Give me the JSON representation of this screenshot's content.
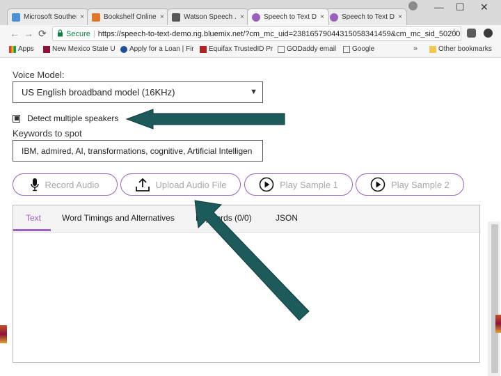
{
  "browser": {
    "tabs": [
      {
        "title": "Microsoft Souther...",
        "favicon_color": "#4a90d9",
        "active": false
      },
      {
        "title": "Bookshelf Online",
        "favicon_color": "#e0772b",
        "active": false
      },
      {
        "title": "Watson Speech ...",
        "favicon_color": "#555555",
        "active": false
      },
      {
        "title": "Speech to Text D...",
        "favicon_color": "#9b5fc0",
        "active": true
      },
      {
        "title": "Speech to Text D...",
        "favicon_color": "#9b5fc0",
        "active": false
      }
    ],
    "tab_close_glyph": "×",
    "window_controls": {
      "minimize": "—",
      "maximize": "☐",
      "close": "✕"
    },
    "nav": {
      "back": "←",
      "forward": "→",
      "reload": "⟳"
    },
    "secure_label": "Secure",
    "url": "https://speech-to-text-demo.ng.bluemix.net/?cm_mc_uid=23816579044315058341459&cm_mc_sid_50200...",
    "bookmarks": [
      {
        "label": "Apps",
        "icon_color": "#d94040"
      },
      {
        "label": "New Mexico State U",
        "icon_color": "#8a1538"
      },
      {
        "label": "Apply for a Loan | Fir",
        "icon_color": "#1f4e9c"
      },
      {
        "label": "Equifax TrustedID Pr",
        "icon_color": "#b22222"
      },
      {
        "label": "GODaddy email",
        "icon_color": "#777777"
      },
      {
        "label": "Google",
        "icon_color": "#777777"
      }
    ],
    "bookmarks_more": "»",
    "other_bookmarks": "Other bookmarks"
  },
  "form": {
    "voice_model_label": "Voice Model:",
    "voice_model_value": "US English broadband model (16KHz)",
    "detect_speakers_label": "Detect multiple speakers",
    "detect_speakers_checked": true,
    "keywords_label": "Keywords to spot",
    "keywords_value": "IBM, admired, AI, transformations, cognitive, Artificial Intelligen"
  },
  "buttons": {
    "record": "Record Audio",
    "upload": "Upload Audio File",
    "sample1": "Play Sample 1",
    "sample2": "Play Sample 2"
  },
  "output_tabs": [
    {
      "label": "Text",
      "active": true
    },
    {
      "label": "Word Timings and Alternatives",
      "active": false
    },
    {
      "label": "Keywords (0/0)",
      "active": false
    },
    {
      "label": "JSON",
      "active": false
    }
  ],
  "colors": {
    "accent": "#9b5fc0",
    "annotation_arrow": "#1d5b5b"
  }
}
